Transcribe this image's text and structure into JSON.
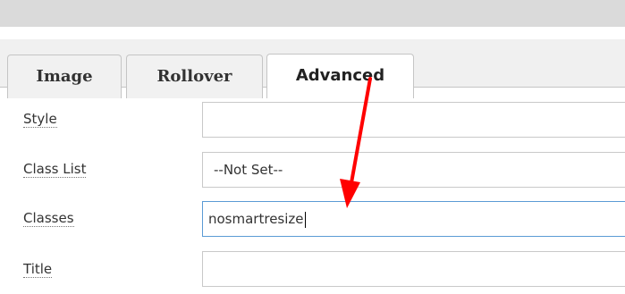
{
  "tabs": [
    {
      "label": "Image",
      "active": false
    },
    {
      "label": "Rollover",
      "active": false
    },
    {
      "label": "Advanced",
      "active": true
    }
  ],
  "fields": {
    "style": {
      "label": "Style",
      "value": ""
    },
    "class_list": {
      "label": "Class List",
      "selected": "--Not Set--"
    },
    "classes": {
      "label": "Classes",
      "value": "nosmartresize"
    },
    "title": {
      "label": "Title",
      "value": ""
    }
  },
  "colors": {
    "annotation_arrow": "#ff0000",
    "focus_border": "#5b9bd5"
  },
  "icons": {
    "annotation": "red-arrow-icon"
  }
}
